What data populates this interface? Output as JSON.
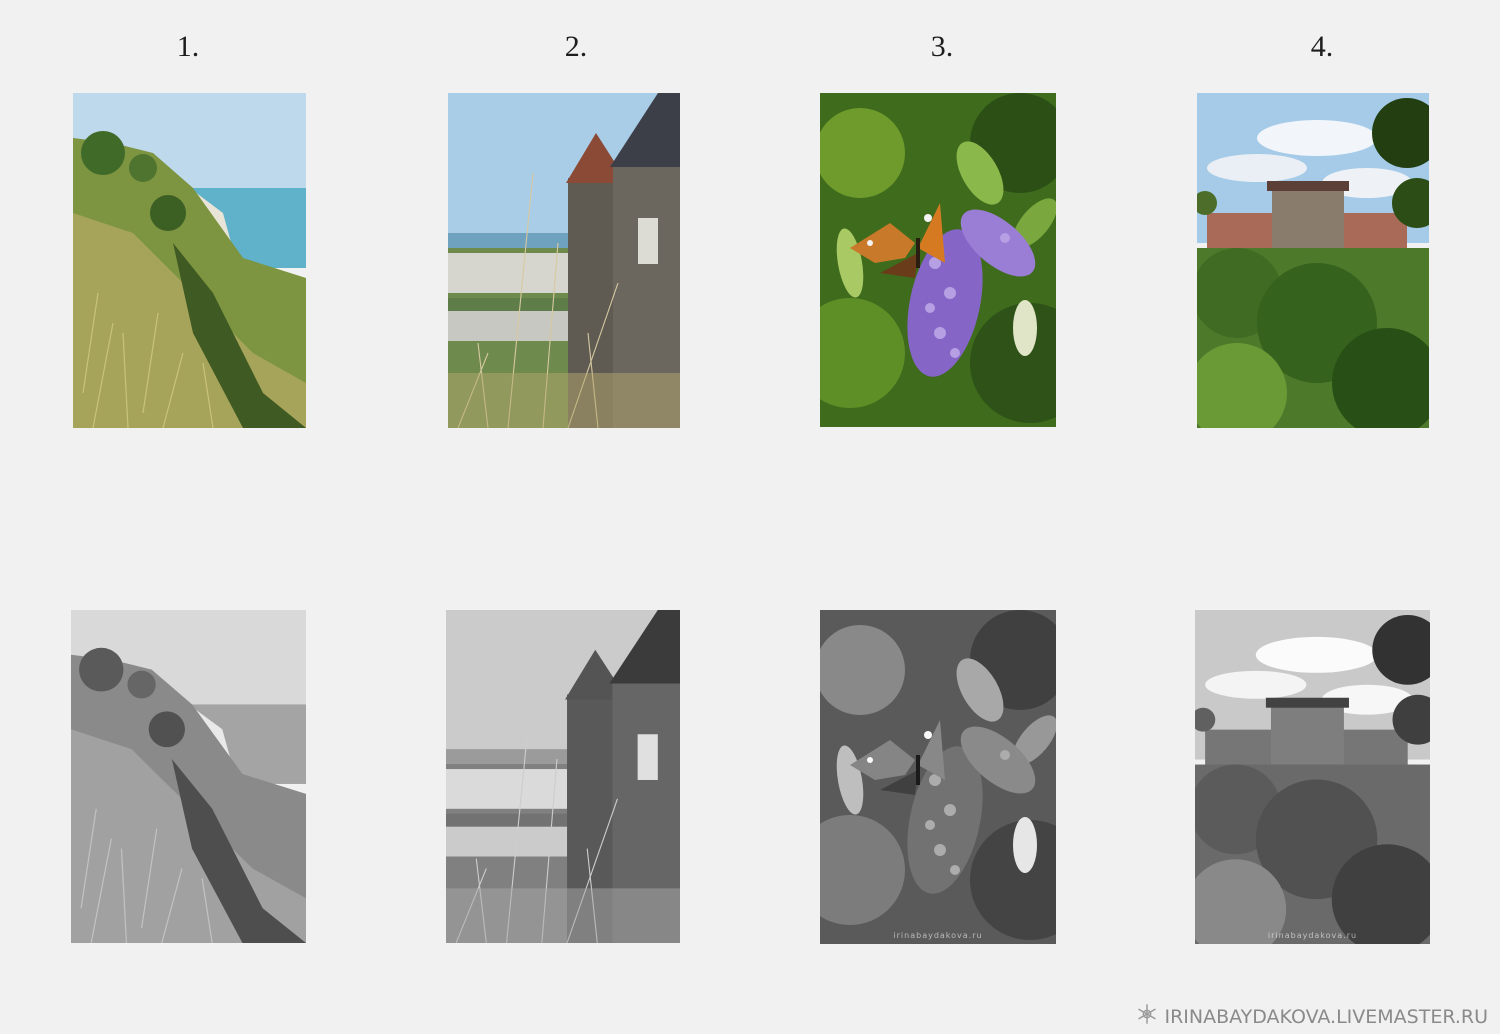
{
  "labels": [
    "1.",
    "2.",
    "3.",
    "4."
  ],
  "photos": [
    {
      "subject": "sea-cliff-grass",
      "top_row": "color",
      "bottom_row": "black-and-white"
    },
    {
      "subject": "castle-tower-over-coast",
      "top_row": "color",
      "bottom_row": "black-and-white"
    },
    {
      "subject": "butterfly-on-buddleia",
      "top_row": "color",
      "bottom_row": "black-and-white"
    },
    {
      "subject": "fortress-with-greenery",
      "top_row": "color",
      "bottom_row": "black-and-white"
    }
  ],
  "watermark": "irinabaydakova.ru",
  "footer": {
    "site": "IRINABAYDAKOVA.LIVEMASTER.RU",
    "logo_icon": "snowflake-flower-icon"
  }
}
